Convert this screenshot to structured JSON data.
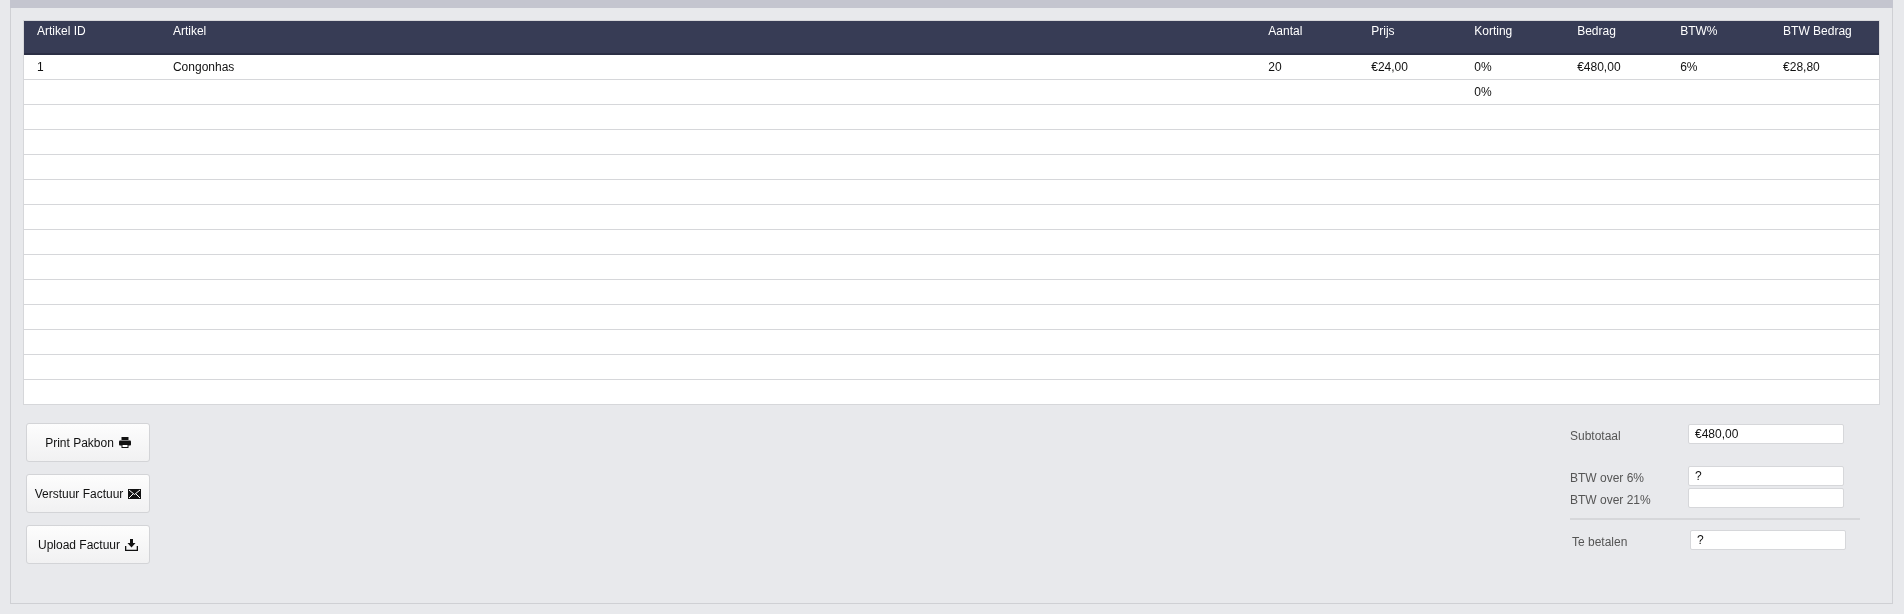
{
  "table": {
    "columns": [
      "Artikel ID",
      "Artikel",
      "Aantal",
      "Prijs",
      "Korting",
      "Bedrag",
      "BTW%",
      "BTW Bedrag"
    ],
    "rows": [
      {
        "artikel_id": "1",
        "artikel": "Congonhas",
        "aantal": "20",
        "prijs": "€24,00",
        "korting": "0%",
        "bedrag": "€480,00",
        "btw_pct": "6%",
        "btw_bedrag": "€28,80"
      },
      {
        "korting": "0%"
      }
    ]
  },
  "buttons": [
    {
      "label": "Print Pakbon",
      "kind": "print"
    },
    {
      "label": "Verstuur Factuur",
      "kind": "send"
    },
    {
      "label": "Upload Factuur",
      "kind": "upload"
    }
  ],
  "totals": [
    {
      "label": "Subtotaal",
      "value": "€480,00"
    },
    {
      "label": "BTW over 6%",
      "value": "?"
    },
    {
      "label": "BTW over 21%"
    },
    {
      "label": "Te betalen",
      "value": "?"
    }
  ]
}
